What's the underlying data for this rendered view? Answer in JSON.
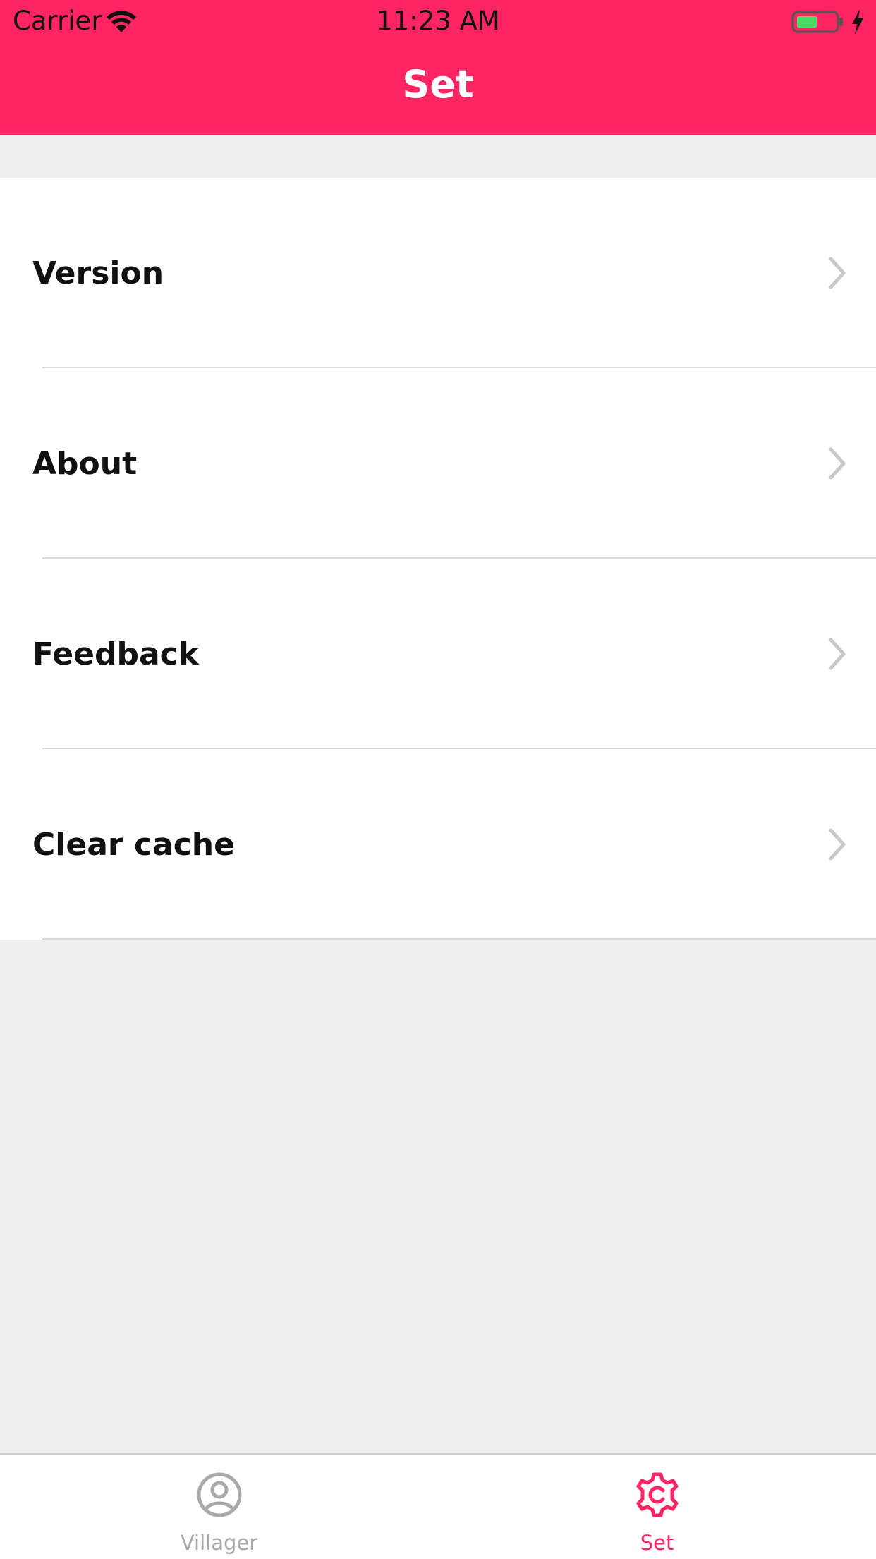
{
  "status_bar": {
    "carrier": "Carrier",
    "time": "11:23 AM"
  },
  "nav": {
    "title": "Set",
    "background_color": "#ff2562"
  },
  "settings": {
    "items": [
      {
        "label": "Version"
      },
      {
        "label": "About"
      },
      {
        "label": "Feedback"
      },
      {
        "label": "Clear cache"
      }
    ]
  },
  "tabbar": {
    "tabs": [
      {
        "label": "Villager",
        "icon": "person-circle-icon",
        "color": "#a9a9a9"
      },
      {
        "label": "Set",
        "icon": "gear-icon",
        "color": "#ff2562",
        "selected": true
      }
    ]
  }
}
